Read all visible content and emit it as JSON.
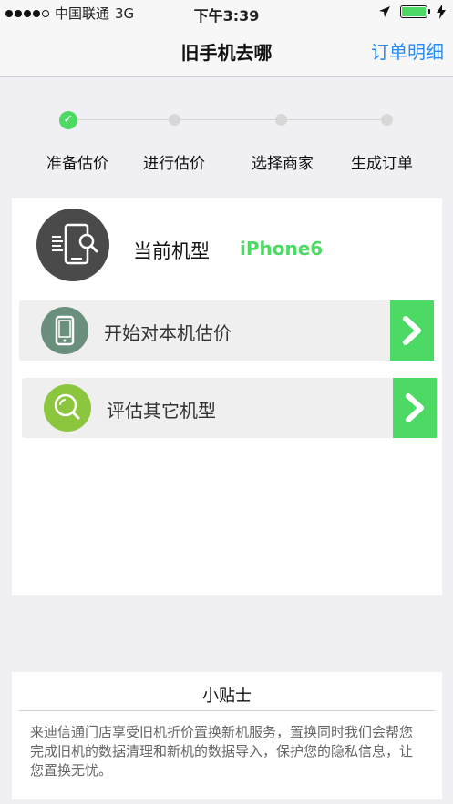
{
  "status_bar": {
    "carrier": "中国联通",
    "network": "3G",
    "time": "下午3:39",
    "signal_strength": "4 of 5 dots",
    "battery_level": 1.0,
    "icons": [
      "location-arrow-icon",
      "battery-icon",
      "charging-icon"
    ]
  },
  "nav": {
    "title": "旧手机去哪",
    "action": "订单明细"
  },
  "steps": {
    "items": [
      {
        "label": "准备估价",
        "state": "done"
      },
      {
        "label": "进行估价",
        "state": "pending"
      },
      {
        "label": "选择商家",
        "state": "pending"
      },
      {
        "label": "生成订单",
        "state": "pending"
      }
    ]
  },
  "current_model": {
    "label": "当前机型",
    "value": "iPhone6",
    "icon": "phone-search-icon"
  },
  "options": [
    {
      "label": "开始对本机估价",
      "icon": "phone-icon",
      "icon_color": "#6a8f7d"
    },
    {
      "label": "评估其它机型",
      "icon": "search-icon",
      "icon_color": "#8cc63f"
    }
  ],
  "tips": {
    "title": "小贴士",
    "text": "来迪信通门店享受旧机折价置换新机服务，置换同时我们会帮您完成旧机的数据清理和新机的数据导入，保护您的隐私信息，让您置换无忧。"
  },
  "colors": {
    "accent_green": "#4cd964",
    "link_blue": "#2a8bf2",
    "background": "#efeff4"
  }
}
